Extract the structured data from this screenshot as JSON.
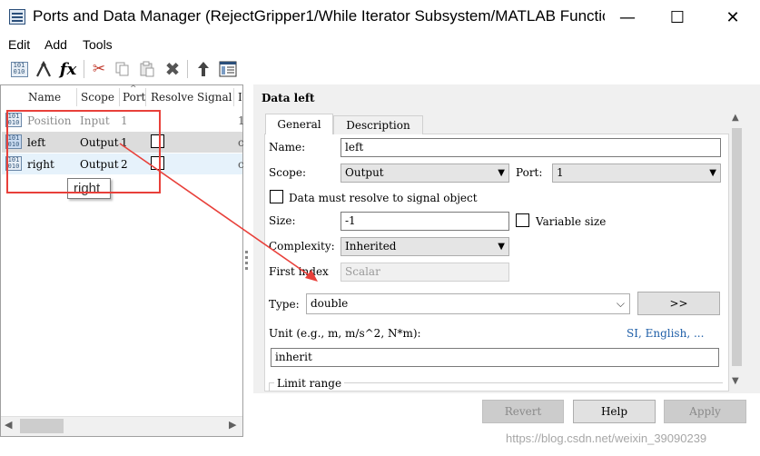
{
  "window": {
    "title": "Ports and Data Manager (RejectGripper1/While Iterator Subsystem/MATLAB Functio...",
    "minimize_glyph": "—",
    "maximize_glyph": "☐",
    "close_glyph": "✕"
  },
  "menu": [
    "Edit",
    "Add",
    "Tools"
  ],
  "toolbar": {
    "icons": [
      "add-data-icon",
      "add-event-icon",
      "add-function-icon",
      "cut-icon",
      "copy-icon",
      "paste-icon",
      "delete-icon",
      "move-up-icon",
      "model-explorer-icon"
    ],
    "fx_label": "fx"
  },
  "table": {
    "columns": [
      "Name",
      "Scope",
      "Port",
      "Resolve Signal",
      "I"
    ],
    "rows": [
      {
        "name": "Position",
        "scope": "Input",
        "port": "1",
        "resolve": "",
        "extra": "1",
        "state": "dimmed"
      },
      {
        "name": "left",
        "scope": "Output",
        "port": "1",
        "resolve": "checkbox",
        "extra": "c",
        "state": "selected"
      },
      {
        "name": "right",
        "scope": "Output",
        "port": "2",
        "resolve": "checkbox",
        "extra": "c",
        "state": "hover"
      }
    ],
    "tooltip": "right"
  },
  "details": {
    "heading": "Data left",
    "tabs": [
      "General",
      "Description"
    ],
    "name_label": "Name:",
    "name_value": "left",
    "scope_label": "Scope:",
    "scope_value": "Output",
    "port_label": "Port:",
    "port_value": "1",
    "resolve_label": "Data must resolve to signal object",
    "size_label": "Size:",
    "size_value": "-1",
    "variable_size_label": "Variable size",
    "complexity_label": "Complexity:",
    "complexity_value": "Inherited",
    "first_index_label": "First index",
    "first_index_value": "Scalar",
    "type_label": "Type:",
    "type_value": "double",
    "type_button": ">>",
    "unit_label": "Unit (e.g., m, m/s^2, N*m):",
    "unit_links": "SI, English, ...",
    "unit_value": "inherit",
    "limit_range_label": "Limit range"
  },
  "buttons": {
    "revert": "Revert",
    "help": "Help",
    "apply": "Apply"
  },
  "watermark": "https://blog.csdn.net/weixin_39090239",
  "colors": {
    "annotation_red": "#e8403a",
    "selected_row": "#dcdcdc",
    "hover_row": "#e6f2fb",
    "link_blue": "#1f5fa8"
  }
}
